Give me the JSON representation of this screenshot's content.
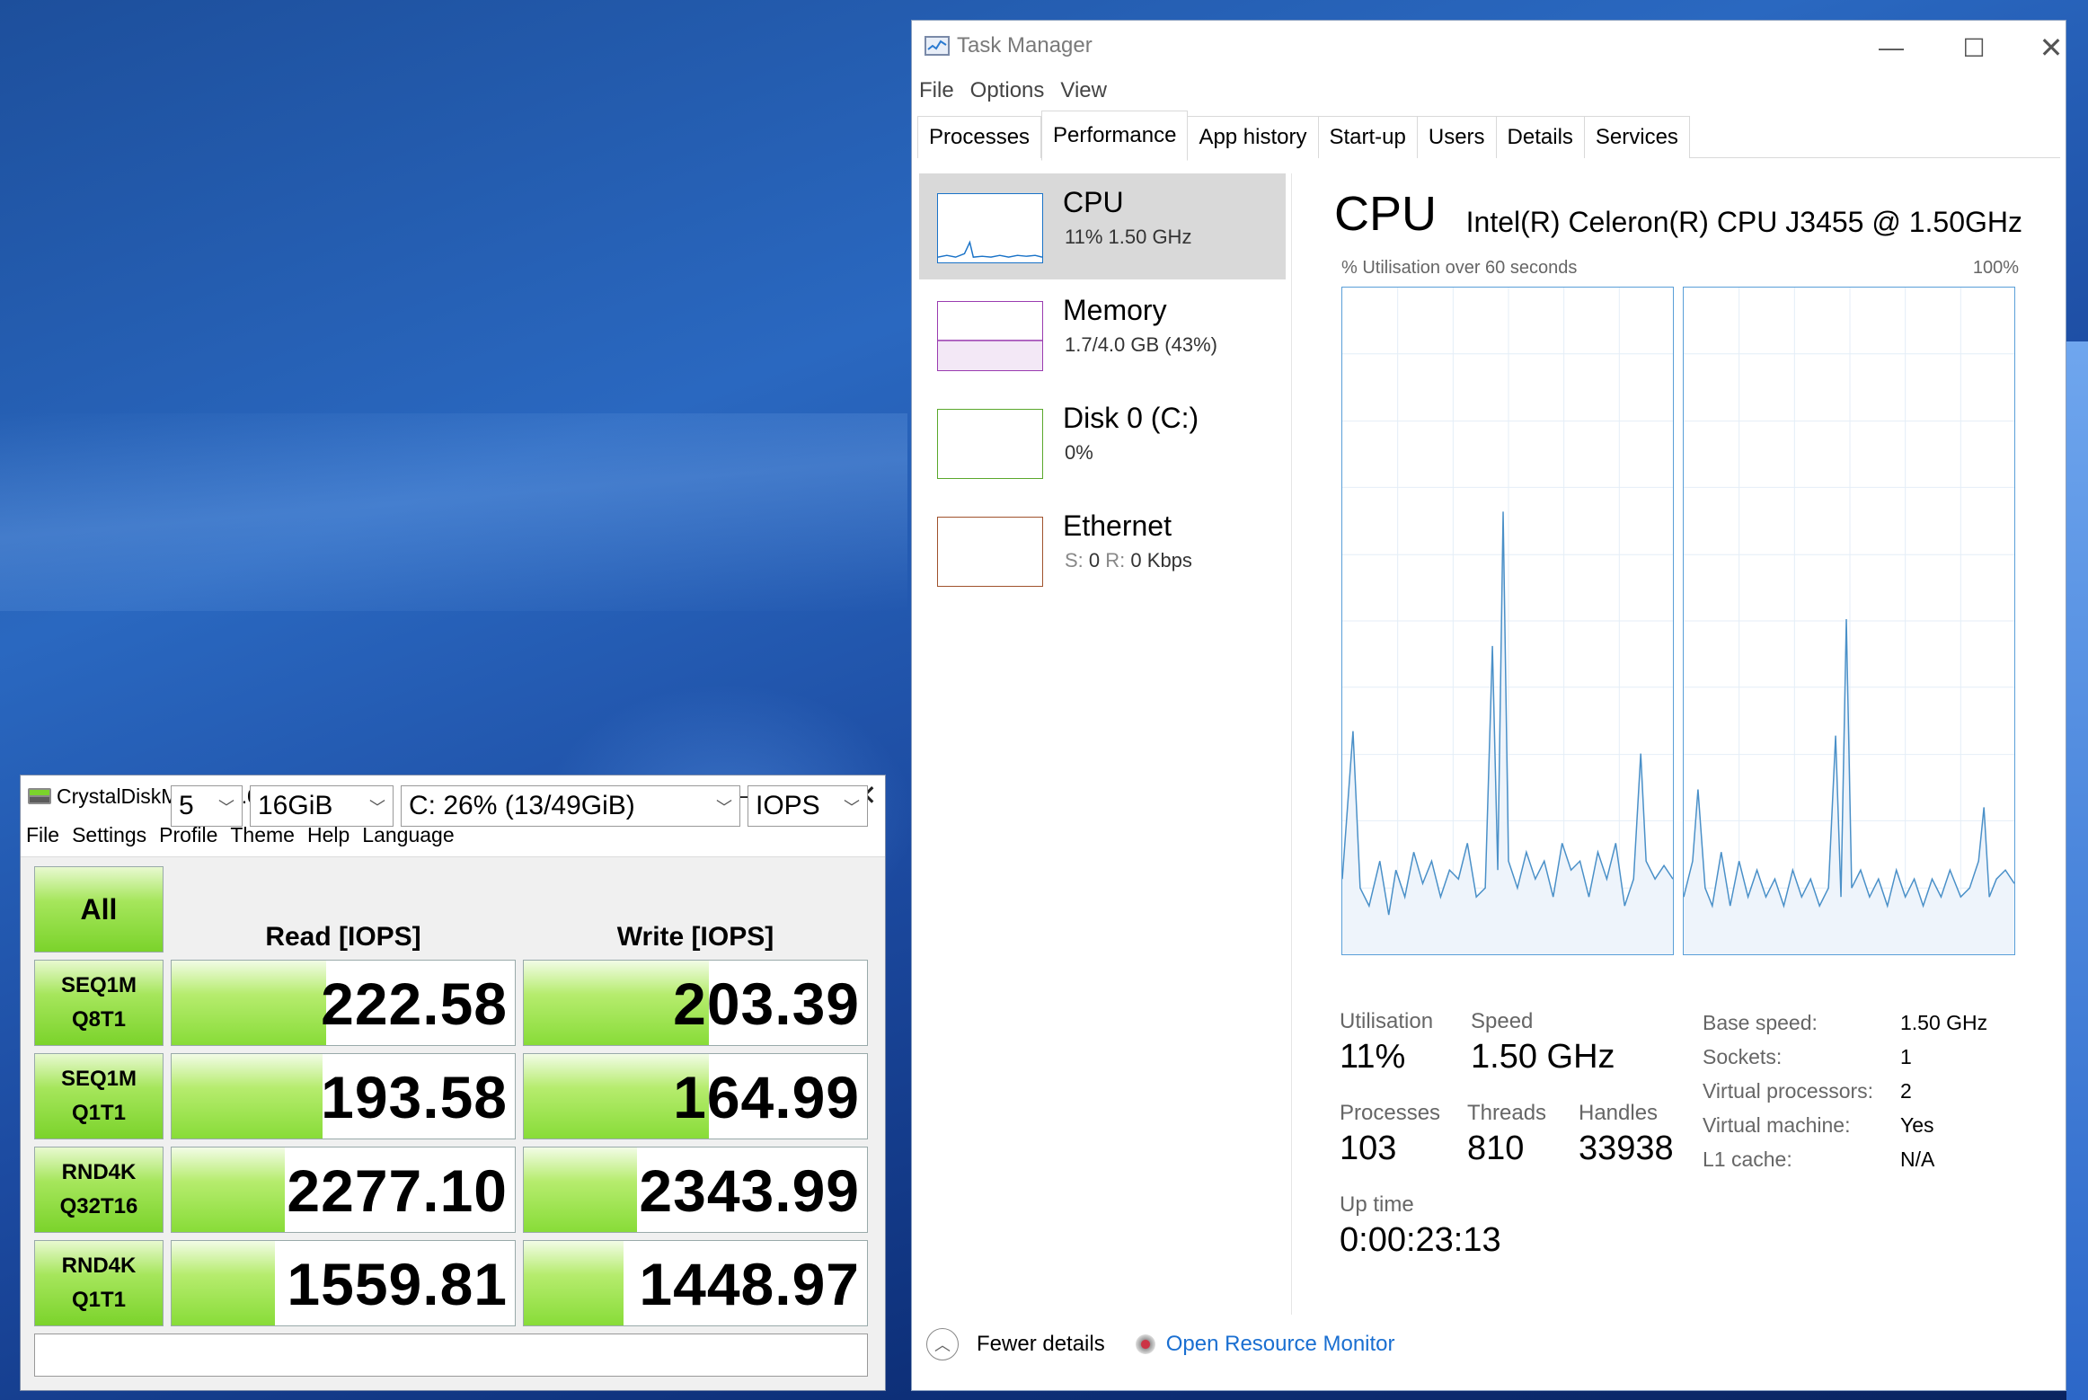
{
  "task_manager": {
    "title": "Task Manager",
    "menu": [
      "File",
      "Options",
      "View"
    ],
    "tabs": [
      "Processes",
      "Performance",
      "App history",
      "Start-up",
      "Users",
      "Details",
      "Services"
    ],
    "active_tab": "Performance",
    "sidebar": [
      {
        "name": "CPU",
        "sub": "11%  1.50 GHz",
        "color": "#1a73c8"
      },
      {
        "name": "Memory",
        "sub": "1.7/4.0 GB (43%)",
        "color": "#9a3cb0"
      },
      {
        "name": "Disk 0 (C:)",
        "sub": "0%",
        "color": "#5aa82c"
      },
      {
        "name": "Ethernet",
        "sub_s_label": "S:",
        "sub_s": "0",
        "sub_r_label": "R:",
        "sub_r": "0 Kbps",
        "color": "#a0522d"
      }
    ],
    "main": {
      "title": "CPU",
      "model": "Intel(R) Celeron(R) CPU J3455 @ 1.50GHz",
      "graph_label": "% Utilisation over 60 seconds",
      "graph_max": "100%",
      "utilisation_label": "Utilisation",
      "utilisation": "11%",
      "speed_label": "Speed",
      "speed": "1.50 GHz",
      "processes_label": "Processes",
      "processes": "103",
      "threads_label": "Threads",
      "threads": "810",
      "handles_label": "Handles",
      "handles": "33938",
      "uptime_label": "Up time",
      "uptime": "0:00:23:13",
      "specs": [
        {
          "k": "Base speed:",
          "v": "1.50 GHz"
        },
        {
          "k": "Sockets:",
          "v": "1"
        },
        {
          "k": "Virtual processors:",
          "v": "2"
        },
        {
          "k": "Virtual machine:",
          "v": "Yes"
        },
        {
          "k": "L1 cache:",
          "v": "N/A"
        }
      ]
    },
    "footer": {
      "fewer_details": "Fewer details",
      "open_resource_monitor": "Open Resource Monitor"
    }
  },
  "crystaldiskmark": {
    "title": "CrystalDiskMark 7.0.0 x64 [ADMIN]",
    "menu": [
      "File",
      "Settings",
      "Profile",
      "Theme",
      "Help",
      "Language"
    ],
    "all_button": "All",
    "count": "5",
    "size": "16GiB",
    "drive": "C: 26% (13/49GiB)",
    "unit": "IOPS",
    "read_header": "Read [IOPS]",
    "write_header": "Write [IOPS]",
    "rows": [
      {
        "l1": "SEQ1M",
        "l2": "Q8T1",
        "read": "222.58",
        "write": "203.39",
        "read_fill": 0.45,
        "write_fill": 0.54
      },
      {
        "l1": "SEQ1M",
        "l2": "Q1T1",
        "read": "193.58",
        "write": "164.99",
        "read_fill": 0.44,
        "write_fill": 0.54
      },
      {
        "l1": "RND4K",
        "l2": "Q32T16",
        "read": "2277.10",
        "write": "2343.99",
        "read_fill": 0.33,
        "write_fill": 0.33
      },
      {
        "l1": "RND4K",
        "l2": "Q1T1",
        "read": "1559.81",
        "write": "1448.97",
        "read_fill": 0.3,
        "write_fill": 0.29
      }
    ]
  }
}
